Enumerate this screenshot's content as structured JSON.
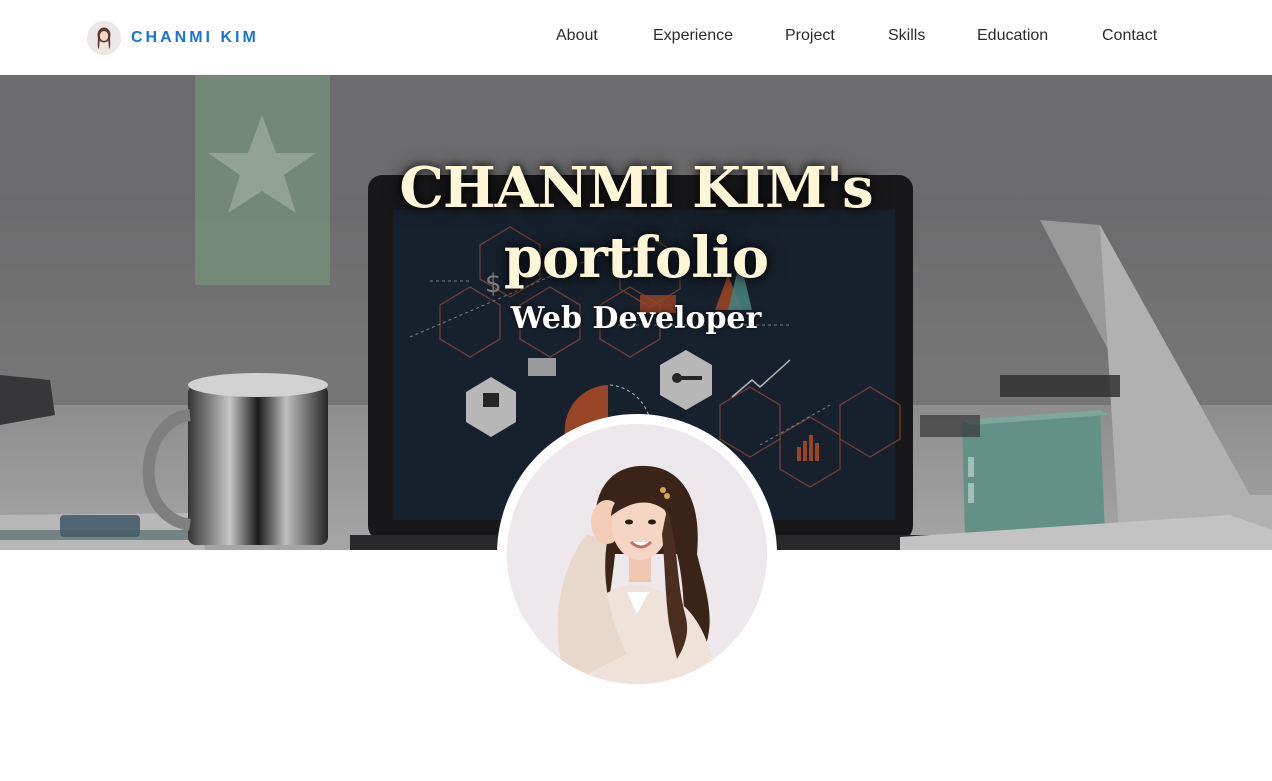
{
  "brand": {
    "name": "CHANMI KIM"
  },
  "nav": {
    "items": [
      {
        "label": "About"
      },
      {
        "label": "Experience"
      },
      {
        "label": "Project"
      },
      {
        "label": "Skills"
      },
      {
        "label": "Education"
      },
      {
        "label": "Contact"
      }
    ]
  },
  "hero": {
    "title_line1": "CHANMI KIM's",
    "title_line2": "portfolio",
    "subtitle": "Web Developer"
  },
  "colors": {
    "brand": "#1a73d9",
    "nav_text": "#2b2b2b",
    "title": "#fff6d8"
  }
}
